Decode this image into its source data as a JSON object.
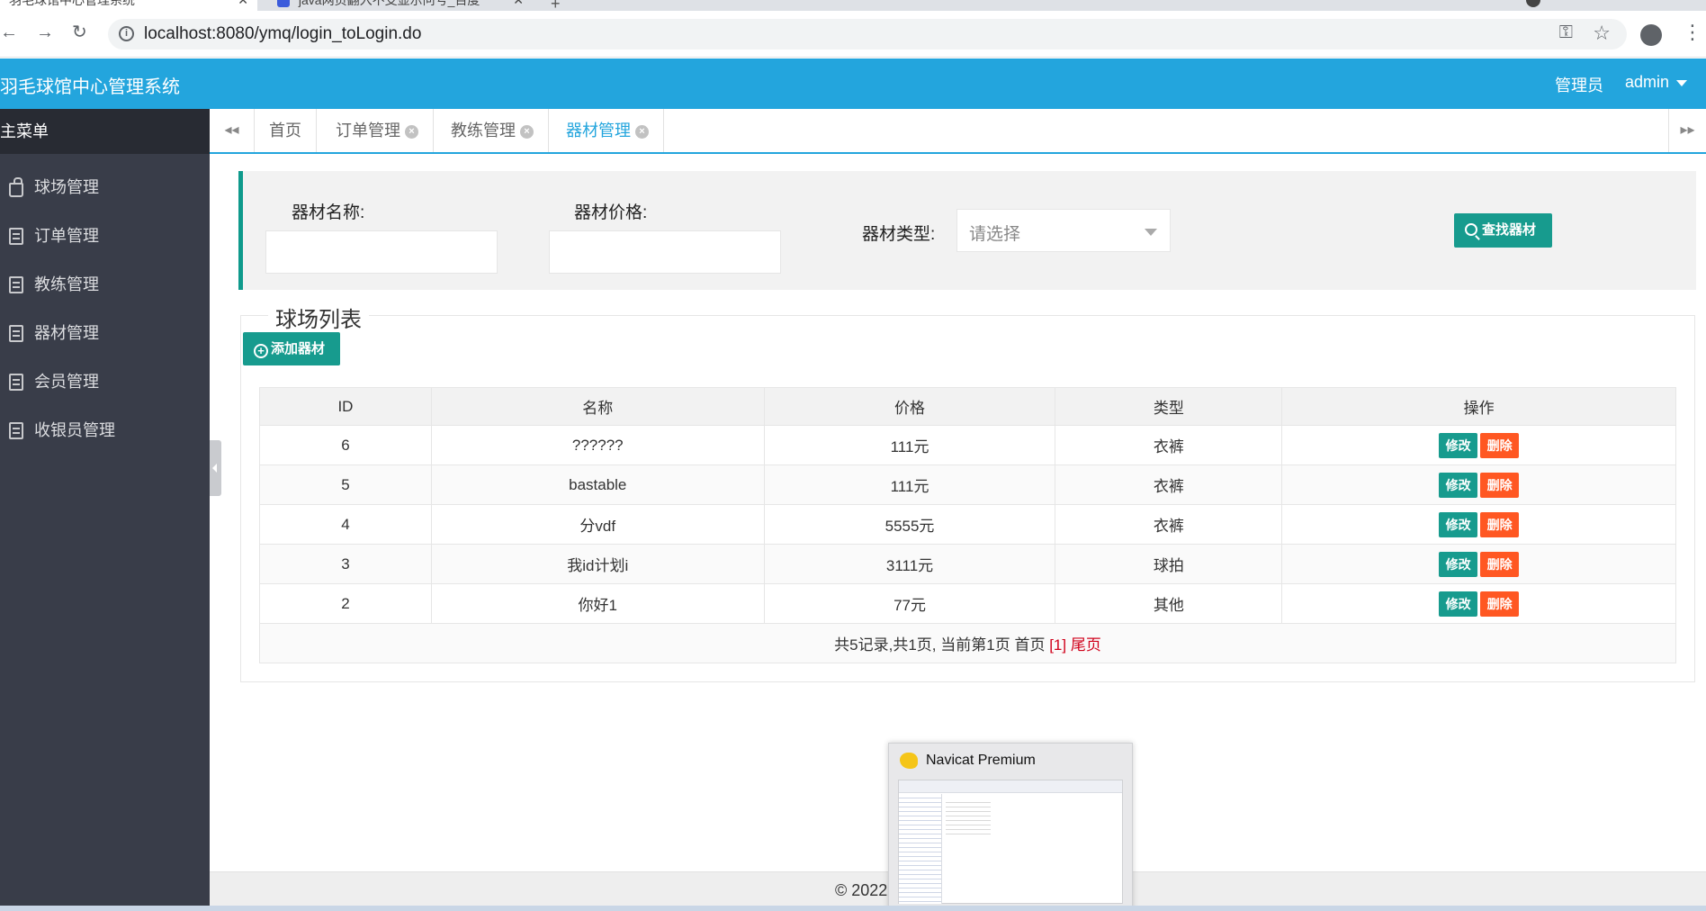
{
  "browser": {
    "tabs": [
      {
        "title": "羽毛球馆中心管理系统",
        "active": true
      },
      {
        "title": "java网页翻入不支显示问号_百度",
        "active": false
      }
    ],
    "url": "localhost:8080/ymq/login_toLogin.do"
  },
  "header": {
    "title": "羽毛球馆中心管理系统",
    "role": "管理员",
    "user": "admin"
  },
  "sidebar": {
    "heading": "主菜单",
    "items": [
      {
        "label": "球场管理",
        "icon": "bag-icon"
      },
      {
        "label": "订单管理",
        "icon": "document-icon"
      },
      {
        "label": "教练管理",
        "icon": "document-icon"
      },
      {
        "label": "器材管理",
        "icon": "document-icon"
      },
      {
        "label": "会员管理",
        "icon": "document-icon"
      },
      {
        "label": "收银员管理",
        "icon": "document-icon"
      }
    ]
  },
  "tabs": [
    {
      "label": "首页",
      "closable": false
    },
    {
      "label": "订单管理",
      "closable": true
    },
    {
      "label": "教练管理",
      "closable": true
    },
    {
      "label": "器材管理",
      "closable": true,
      "active": true
    }
  ],
  "search": {
    "name_label": "器材名称:",
    "name_value": "",
    "price_label": "器材价格:",
    "price_value": "",
    "type_label": "器材类型:",
    "type_placeholder": "请选择",
    "button": "查找器材"
  },
  "list": {
    "legend": "球场列表",
    "add_button": "添加器材",
    "columns": [
      "ID",
      "名称",
      "价格",
      "类型",
      "操作"
    ],
    "rows": [
      {
        "id": "6",
        "name": "??????",
        "price": "111元",
        "type": "衣裤"
      },
      {
        "id": "5",
        "name": "bastable",
        "price": "111元",
        "type": "衣裤"
      },
      {
        "id": "4",
        "name": "分vdf",
        "price": "5555元",
        "type": "衣裤"
      },
      {
        "id": "3",
        "name": "我id计划i",
        "price": "3111元",
        "type": "球拍"
      },
      {
        "id": "2",
        "name": "你好1",
        "price": "77元",
        "type": "其他"
      }
    ],
    "edit_label": "修改",
    "delete_label": "删除",
    "pager": {
      "summary": "共5记录,共1页, 当前第1页",
      "first": "首页",
      "current": "[1]",
      "last": "尾页"
    }
  },
  "footer": {
    "text": "© 2022"
  },
  "taskbar_preview": {
    "title": "Navicat Premium"
  },
  "colors": {
    "header_blue": "#23a5dd",
    "sidebar_bg": "#393d49",
    "teal": "#179b8e",
    "danger": "#ff5722"
  }
}
